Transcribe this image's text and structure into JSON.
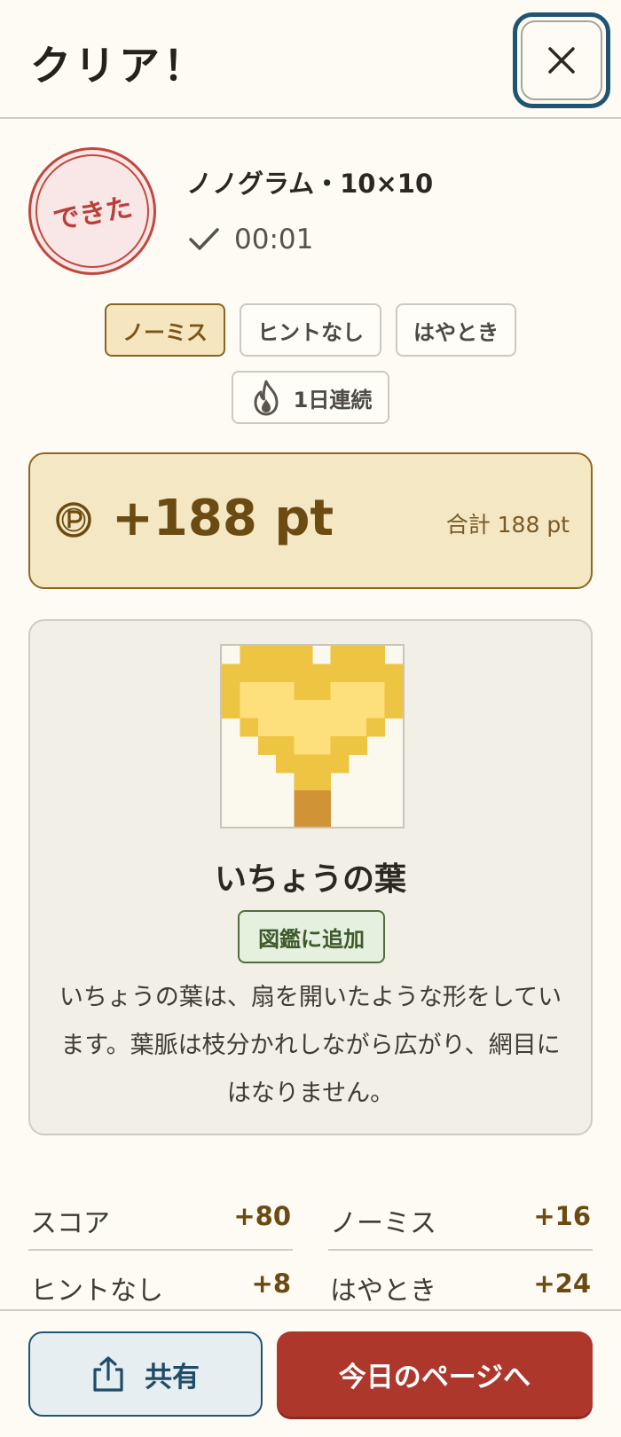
{
  "header": {
    "title": "クリア！",
    "close_icon": "close-icon"
  },
  "result": {
    "stamp_text": "できた",
    "puzzle_name": "ノノグラム・10×10",
    "time": "00:01",
    "time_icon": "check-icon"
  },
  "badges": [
    {
      "label": "ノーミス",
      "highlighted": true
    },
    {
      "label": "ヒントなし",
      "highlighted": false
    },
    {
      "label": "はやとき",
      "highlighted": false
    }
  ],
  "streak": {
    "label": "1日連続",
    "icon": "flame-icon"
  },
  "points": {
    "gained": "+188 pt",
    "total": "合計 188 pt",
    "icon": "points-icon"
  },
  "reward": {
    "name": "いちょうの葉",
    "badge": "図鑑に追加",
    "description": "いちょうの葉は、扇を開いたような形をしています。葉脈は枝分かれしながら広がり、網目にはなりません。",
    "art_colors": {
      "dark": "#eec443",
      "light": "#fde07c",
      "stem": "#d09437",
      "empty": "#fbf8ee"
    }
  },
  "breakdown": [
    {
      "label": "スコア",
      "value": "+80"
    },
    {
      "label": "ノーミス",
      "value": "+16"
    },
    {
      "label": "ヒントなし",
      "value": "+8"
    },
    {
      "label": "はやとき",
      "value": "+24"
    }
  ],
  "footer": {
    "share_label": "共有",
    "share_icon": "share-icon",
    "today_label": "今日のページへ"
  },
  "colors": {
    "accent_blue": "#1f5573",
    "accent_red": "#ae372c",
    "gold": "#6b4b12"
  }
}
